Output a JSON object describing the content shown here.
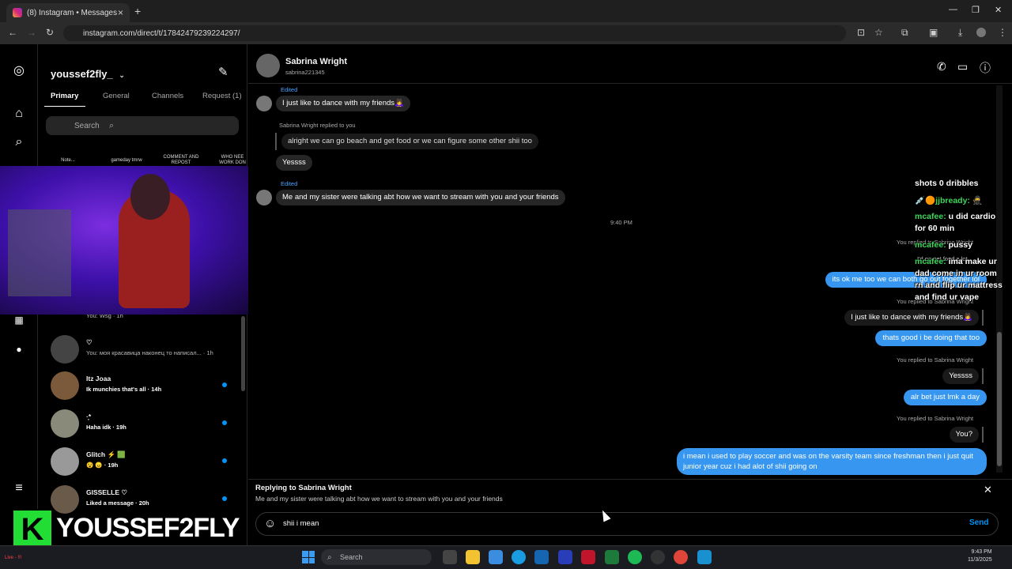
{
  "browser": {
    "tab_title": "(8) Instagram • Messages",
    "url": "instagram.com/direct/t/17842479239224297/"
  },
  "inbox": {
    "username": "youssef2fly_",
    "tabs": [
      "Primary",
      "General",
      "Channels",
      "Request (1)"
    ],
    "search_placeholder": "Search",
    "notes": [
      "Note...",
      "gameday tmrw",
      "COMMENT AND REPOST",
      "WHO NEE WORK DON"
    ],
    "conversations": [
      {
        "name": "",
        "preview": "You: Wsg · 1h",
        "unread": false
      },
      {
        "name": "♡",
        "preview": "You: моя красавица наконец то написал... · 1h",
        "unread": false
      },
      {
        "name": "Itz Joaa",
        "preview": "Ik munchies that's all · 14h",
        "unread": true
      },
      {
        "name": "·̩̩͙*",
        "preview": "Haha idk · 19h",
        "unread": true
      },
      {
        "name": "Glitch ⚡ 🟩",
        "preview": "😵 😠 · 19h",
        "unread": true
      },
      {
        "name": "GISSELLE ♡",
        "preview": "Liked a message · 20h",
        "unread": true
      }
    ]
  },
  "chat": {
    "contact_name": "Sabrina Wright",
    "contact_username": "sabrina221345",
    "messages_left": [
      {
        "edited": "Edited",
        "text": "I just like to dance with my friends🙇‍♀️"
      },
      {
        "reply_meta": "Sabrina Wright replied to you",
        "quoted": "alright we can go beach and get food or we can figure some other shii too",
        "text": "Yessss"
      },
      {
        "edited": "Edited",
        "text": "Me and my sister were talking abt how we want to stream with you and your friends"
      }
    ],
    "timestamp": "9:40 PM",
    "messages_right": [
      {
        "meta": "You replied to Sabrina Wright",
        "quoted": "I'd go get food a lot"
      },
      {
        "text": "its ok me too we can both go out together lol"
      },
      {
        "meta": "You replied to Sabrina Wright",
        "quoted": "I just like to dance with my friends🙇‍♀️"
      },
      {
        "text": "thats good i be doing that too"
      },
      {
        "meta": "You replied to Sabrina Wright",
        "quoted": "Yessss"
      },
      {
        "text": "alr bet just lmk a day"
      },
      {
        "meta": "You replied to Sabrina Wright",
        "quoted": "You?"
      },
      {
        "text": "i mean i used to play soccer and was on the varsity team since freshman then i just quit junior year cuz i had alot of shii going on"
      }
    ],
    "replying_to_label": "Replying to Sabrina Wright",
    "replying_to_text": "Me and my sister were talking abt how we want to stream with you and your friends",
    "input_value": "shii i mean ",
    "send_label": "Send"
  },
  "stream_overlay": {
    "lines": [
      {
        "user": "",
        "text": "shots 0 dribbles"
      },
      {
        "user": "💉🟠jjbready:",
        "text": "🥷"
      },
      {
        "user": "mcafee:",
        "text": "u did cardio"
      },
      {
        "user": "",
        "text": "for 60 min"
      },
      {
        "user": "mcafee:",
        "text": "pussy"
      },
      {
        "user": "mcafee:",
        "text": "ima make ur"
      },
      {
        "user": "",
        "text": "dad come in ur room"
      },
      {
        "user": "",
        "text": "rn and flip ur mattress"
      },
      {
        "user": "",
        "text": "and find ur vape"
      }
    ],
    "brand_letter": "K",
    "brand_name": "YOUSSEF2FLY",
    "live_text": "Live - !!!"
  },
  "taskbar": {
    "search": "Search",
    "time": "9:43 PM",
    "date": "11/3/2025"
  },
  "colors": {
    "accent": "#0095f6",
    "bubble_sent": "#3797f0",
    "bubble_received": "#262626"
  }
}
